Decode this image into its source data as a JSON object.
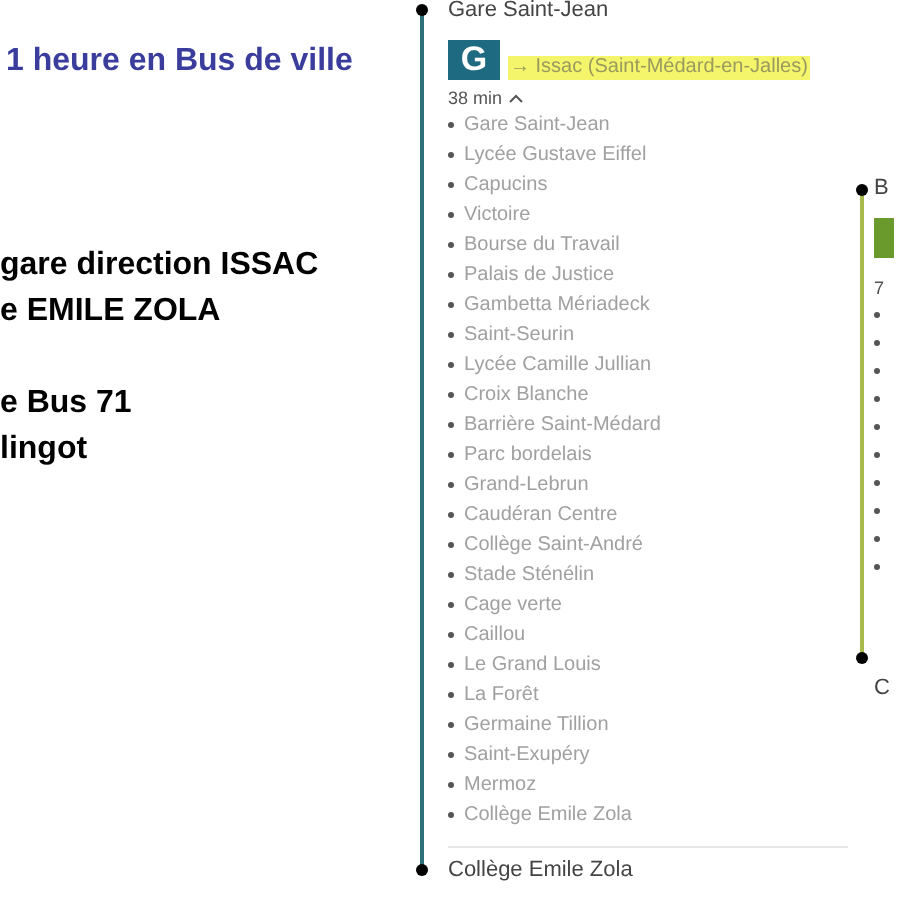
{
  "intro": {
    "title": "1 heure en Bus de ville",
    "groups": [
      [
        "gare direction ISSAC",
        "e EMILE ZOLA"
      ],
      [
        "e Bus 71",
        "lingot"
      ]
    ]
  },
  "route": {
    "departure": "Gare Saint-Jean",
    "line_badge": "G",
    "direction": "→ Issac (Saint-Médard-en-Jalles)",
    "duration": "38 min",
    "expanded": true,
    "stops": [
      "Gare Saint-Jean",
      "Lycée Gustave Eiffel",
      "Capucins",
      "Victoire",
      "Bourse du Travail",
      "Palais de Justice",
      "Gambetta Mériadeck",
      "Saint-Seurin",
      "Lycée Camille Jullian",
      "Croix Blanche",
      "Barrière Saint-Médard",
      "Parc bordelais",
      "Grand-Lebrun",
      "Caudéran Centre",
      "Collège Saint-André",
      "Stade Sténélin",
      "Cage verte",
      "Caillou",
      "Le Grand Louis",
      "La Forêt",
      "Germaine Tillion",
      "Saint-Exupéry",
      "Mermoz",
      "Collège Emile Zola"
    ],
    "arrival": "Collège Emile Zola"
  },
  "next_route": {
    "departure": "B",
    "duration": "7",
    "arrival": "C"
  }
}
